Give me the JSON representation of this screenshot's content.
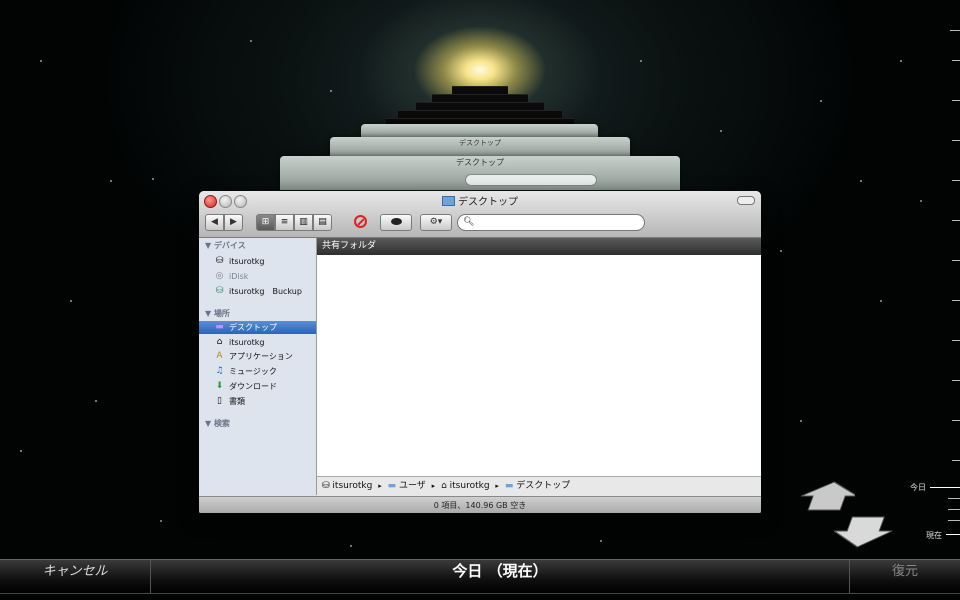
{
  "window": {
    "title": "デスクトップ",
    "view_buttons": [
      "icon-view",
      "list-view",
      "column-view",
      "coverflow-view"
    ],
    "search_placeholder": ""
  },
  "sidebar": {
    "sections": [
      {
        "header": "▼ デバイス",
        "items": [
          {
            "label": "itsurotkg",
            "icon": "drive-icon"
          },
          {
            "label": "iDisk",
            "icon": "idisk-icon",
            "dim": true
          },
          {
            "label": "itsurotkg　Buckup",
            "icon": "backup-drive-icon"
          }
        ]
      },
      {
        "header": "▼ 場所",
        "items": [
          {
            "label": "デスクトップ",
            "icon": "desktop-icon",
            "selected": true
          },
          {
            "label": "itsurotkg",
            "icon": "home-icon"
          },
          {
            "label": "アプリケーション",
            "icon": "applications-icon"
          },
          {
            "label": "ミュージック",
            "icon": "music-icon"
          },
          {
            "label": "ダウンロード",
            "icon": "download-icon"
          },
          {
            "label": "書類",
            "icon": "documents-icon"
          }
        ]
      },
      {
        "header": "▼ 検索",
        "items": []
      }
    ]
  },
  "main": {
    "header": "共有フォルダ",
    "path": [
      "itsurotkg",
      "ユーザ",
      "itsurotkg",
      "デスクトップ"
    ],
    "path_sep": "▸"
  },
  "status_bar": "0 項目、140.96 GB 空き",
  "ghost_titles": [
    "デスクトップ",
    "デスクトップ",
    "デスクトップ"
  ],
  "timeline": {
    "cancel": "キャンセル",
    "current": "今日 （現在）",
    "restore": "復元",
    "labels": {
      "today": "今日",
      "now": "現在"
    }
  }
}
